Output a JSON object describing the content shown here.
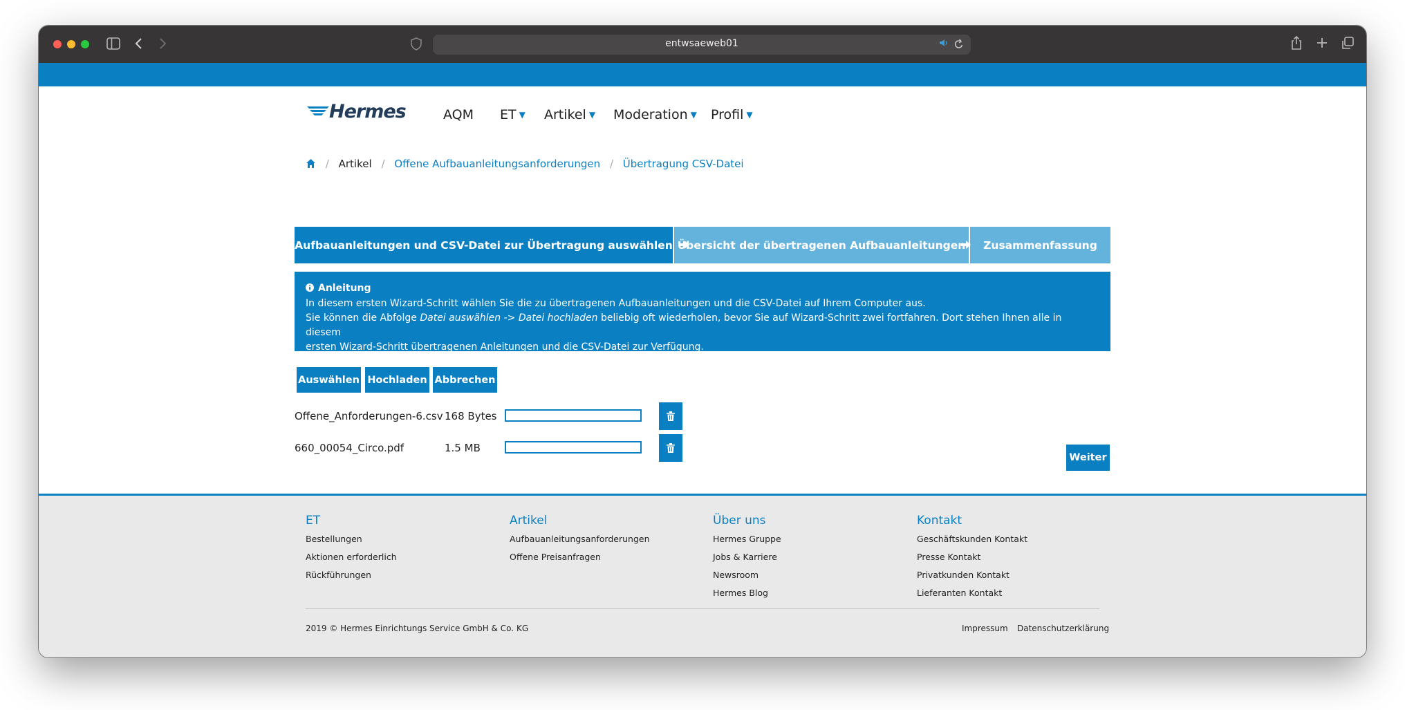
{
  "browser": {
    "address": "entwsaeweb01"
  },
  "brand": {
    "logo_text": "Hermes",
    "accent": "#0a7fc2",
    "accent_light": "#63b3dc"
  },
  "nav": {
    "items": [
      {
        "label": "AQM",
        "dropdown": false
      },
      {
        "label": "ET",
        "dropdown": true
      },
      {
        "label": "Artikel",
        "dropdown": true
      },
      {
        "label": "Moderation",
        "dropdown": true
      },
      {
        "label": "Profil",
        "dropdown": true
      }
    ]
  },
  "breadcrumb": {
    "items": [
      "Artikel",
      "Offene Aufbauanleitungsanforderungen",
      "Übertragung CSV-Datei"
    ]
  },
  "wizard": {
    "steps": [
      "Aufbauanleitungen und CSV-Datei zur Übertragung auswählen",
      "Übersicht der übertragenen Aufbauanleitungen",
      "Zusammenfassung"
    ]
  },
  "info": {
    "title": "Anleitung",
    "line1": "In diesem ersten Wizard-Schritt wählen Sie die zu übertragenen Aufbauanleitungen und die CSV-Datei auf Ihrem Computer aus.",
    "line2_pre": "Sie können die Abfolge ",
    "line2_em": "Datei auswählen -> Datei hochladen",
    "line2_post": " beliebig oft wiederholen, bevor Sie auf Wizard-Schritt zwei fortfahren. Dort stehen Ihnen alle in diesem",
    "line3": "ersten Wizard-Schritt übertragenen Anleitungen und die CSV-Datei zur Verfügung."
  },
  "actions": {
    "select": "Auswählen",
    "upload": "Hochladen",
    "cancel": "Abbrechen",
    "next": "Weiter"
  },
  "files": [
    {
      "name": "Offene_Anforderungen-6.csv",
      "size": "168 Bytes",
      "progress": 0
    },
    {
      "name": "660_00054_Circo.pdf",
      "size": "1.5 MB",
      "progress": 0
    }
  ],
  "footer": {
    "columns": [
      {
        "heading": "ET",
        "links": [
          "Bestellungen",
          "Aktionen erforderlich",
          "Rückführungen"
        ]
      },
      {
        "heading": "Artikel",
        "links": [
          "Aufbauanleitungsanforderungen",
          "Offene Preisanfragen"
        ]
      },
      {
        "heading": "Über uns",
        "links": [
          "Hermes Gruppe",
          "Jobs & Karriere",
          "Newsroom",
          "Hermes Blog"
        ]
      },
      {
        "heading": "Kontakt",
        "links": [
          "Geschäftskunden Kontakt",
          "Presse Kontakt",
          "Privatkunden Kontakt",
          "Lieferanten Kontakt"
        ]
      }
    ],
    "copyright": "2019 © Hermes Einrichtungs Service GmbH & Co. KG",
    "imprint": "Impressum",
    "privacy": "Datenschutzerklärung"
  }
}
